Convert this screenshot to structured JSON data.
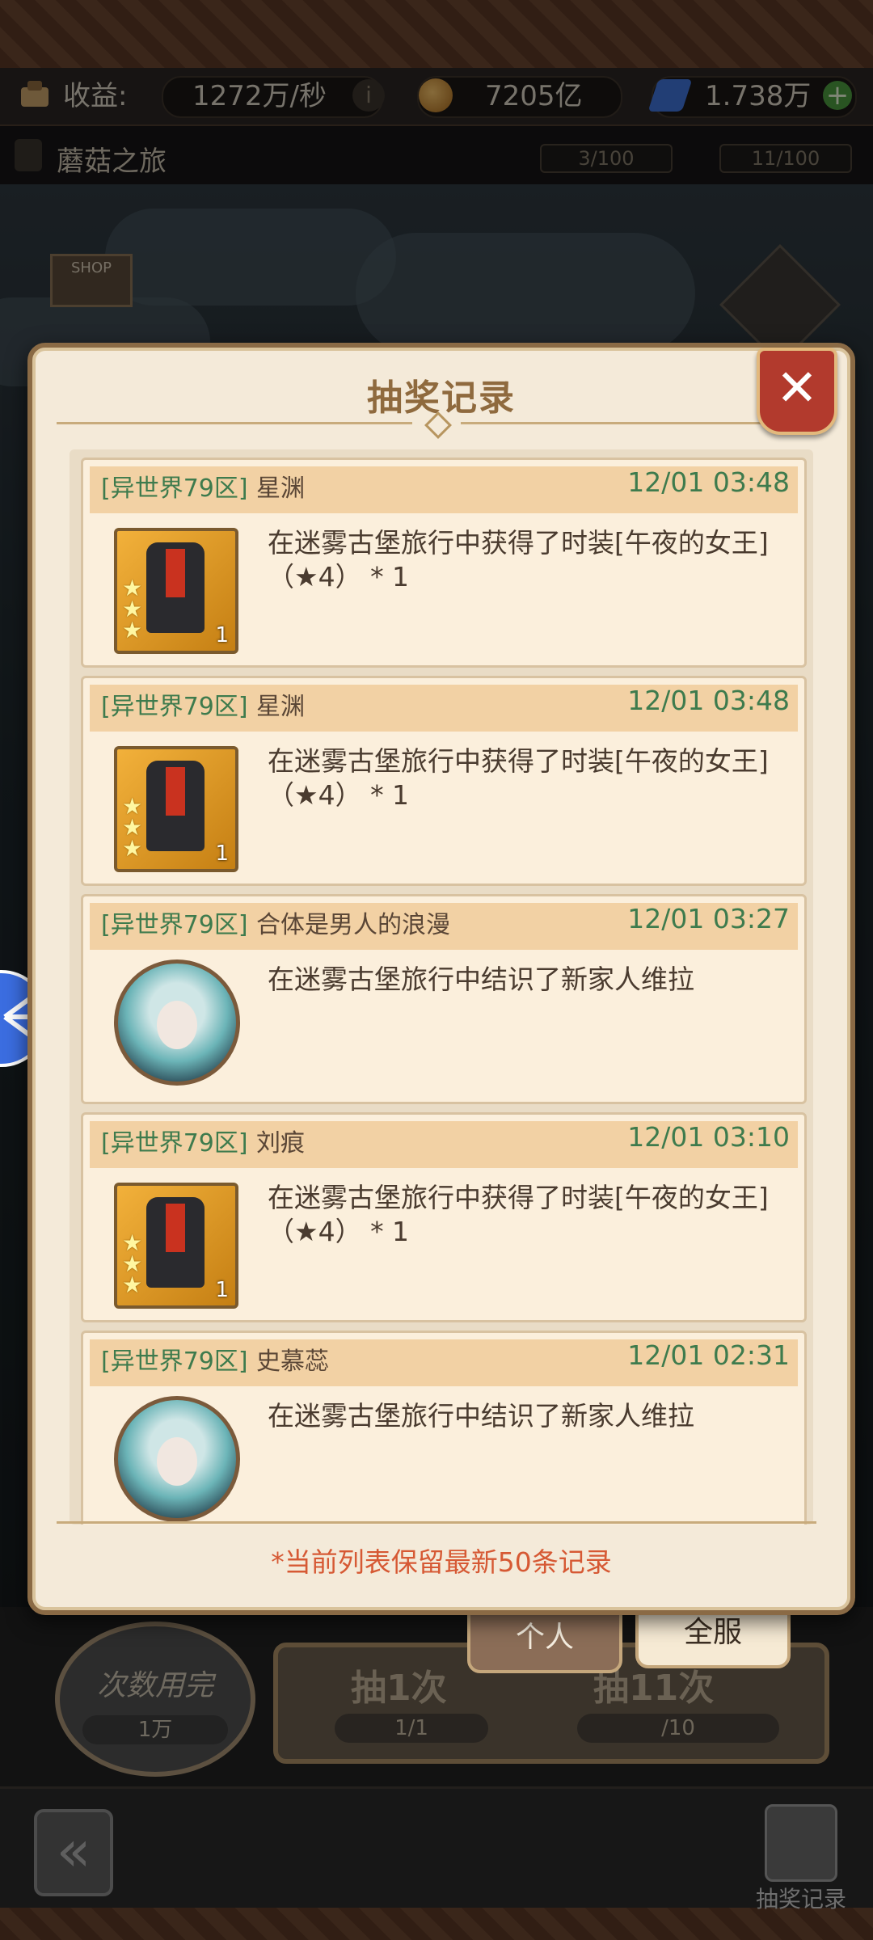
{
  "status_bar": {
    "income_label": "收益:",
    "income_value": "1272万/秒",
    "coins_value": "7205亿",
    "gems_value": "1.738万",
    "add_icon": "plus-icon",
    "info_icon": "info-icon"
  },
  "title_bar": {
    "title": "蘑菇之旅",
    "counter_a": "3/100",
    "counter_b": "11/100"
  },
  "scene": {
    "shop_label": "SHOP"
  },
  "dialog": {
    "title": "抽奖记录",
    "close_icon": "close-icon",
    "footer_note": "*当前列表保留最新50条记录",
    "records": [
      {
        "server": "[异世界79区]",
        "player": "星渊",
        "time": "12/01 03:48",
        "text": "在迷雾古堡旅行中获得了时装[午夜的女王]（★4） * 1",
        "icon": "costume-icon",
        "item_count": "1"
      },
      {
        "server": "[异世界79区]",
        "player": "星渊",
        "time": "12/01 03:48",
        "text": "在迷雾古堡旅行中获得了时装[午夜的女王]（★4） * 1",
        "icon": "costume-icon",
        "item_count": "1"
      },
      {
        "server": "[异世界79区]",
        "player": "合体是男人的浪漫",
        "time": "12/01 03:27",
        "text": "在迷雾古堡旅行中结识了新家人维拉",
        "icon": "character-avatar-icon",
        "item_count": ""
      },
      {
        "server": "[异世界79区]",
        "player": "刘痕",
        "time": "12/01 03:10",
        "text": "在迷雾古堡旅行中获得了时装[午夜的女王]（★4） * 1",
        "icon": "costume-icon",
        "item_count": "1"
      },
      {
        "server": "[异世界79区]",
        "player": "史慕蕊",
        "time": "12/01 02:31",
        "text": "在迷雾古堡旅行中结识了新家人维拉",
        "icon": "character-avatar-icon",
        "item_count": ""
      }
    ]
  },
  "tabs": {
    "personal": "个人",
    "server": "全服"
  },
  "draw": {
    "used_up_label": "次数用完",
    "used_up_cost": "1万",
    "draw1_label": "抽1次",
    "draw1_count": "1/1",
    "draw11_label": "抽11次",
    "draw11_count": "/10"
  },
  "bottom_nav": {
    "record_label": "抽奖记录"
  }
}
